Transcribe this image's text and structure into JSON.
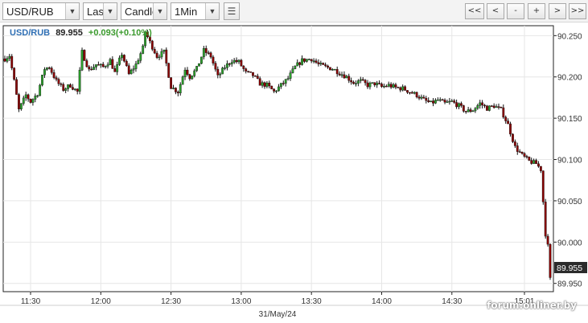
{
  "toolbar": {
    "symbol": "USD/RUB",
    "price_type": "Last",
    "chart_style": "Candle",
    "interval": "1Min",
    "list_icon": "list-icon",
    "nav": [
      "<<",
      "<",
      "-",
      "+",
      ">",
      ">>"
    ]
  },
  "quote": {
    "symbol": "USD/RUB",
    "price": "89.955",
    "change": "+0.093(+0.10%)"
  },
  "colors": {
    "up": "#2ca02c",
    "down": "#8b0000",
    "symbol": "#2f6fb4",
    "change": "#3a9a2c",
    "grid": "#e6e6e6"
  },
  "watermark": "forum.onliner.by",
  "chart_data": {
    "type": "candlestick",
    "title": "USD/RUB 89.955 +0.093(+0.10%)",
    "date_label": "31/May/24",
    "x_ticks": [
      "11:30",
      "12:00",
      "12:30",
      "13:00",
      "13:30",
      "14:00",
      "14:30",
      "15:01"
    ],
    "y_ticks": [
      "90.250",
      "90.200",
      "90.150",
      "90.100",
      "90.050",
      "90.000",
      "89.950"
    ],
    "ylim": [
      89.94,
      90.262
    ],
    "x_range": [
      "11:19",
      "15:12"
    ],
    "last_price_label": "89.955",
    "grid": true,
    "keypoints": [
      [
        "11:19",
        90.222
      ],
      [
        "11:21",
        90.226
      ],
      [
        "11:23",
        90.195
      ],
      [
        "11:25",
        90.16
      ],
      [
        "11:28",
        90.178
      ],
      [
        "11:30",
        90.17
      ],
      [
        "11:33",
        90.18
      ],
      [
        "11:36",
        90.21
      ],
      [
        "11:38",
        90.212
      ],
      [
        "11:41",
        90.195
      ],
      [
        "11:44",
        90.185
      ],
      [
        "11:47",
        90.19
      ],
      [
        "11:50",
        90.182
      ],
      [
        "11:52",
        90.23
      ],
      [
        "11:55",
        90.208
      ],
      [
        "11:58",
        90.215
      ],
      [
        "12:01",
        90.212
      ],
      [
        "12:04",
        90.22
      ],
      [
        "12:06",
        90.205
      ],
      [
        "12:09",
        90.228
      ],
      [
        "12:12",
        90.203
      ],
      [
        "12:15",
        90.215
      ],
      [
        "12:18",
        90.235
      ],
      [
        "12:19",
        90.255
      ],
      [
        "12:21",
        90.242
      ],
      [
        "12:24",
        90.225
      ],
      [
        "12:27",
        90.23
      ],
      [
        "12:30",
        90.188
      ],
      [
        "12:33",
        90.182
      ],
      [
        "12:36",
        90.21
      ],
      [
        "12:38",
        90.2
      ],
      [
        "12:41",
        90.21
      ],
      [
        "12:44",
        90.232
      ],
      [
        "12:47",
        90.225
      ],
      [
        "12:50",
        90.2
      ],
      [
        "12:53",
        90.212
      ],
      [
        "12:56",
        90.22
      ],
      [
        "12:59",
        90.218
      ],
      [
        "13:02",
        90.205
      ],
      [
        "13:05",
        90.202
      ],
      [
        "13:08",
        90.192
      ],
      [
        "13:11",
        90.19
      ],
      [
        "13:14",
        90.182
      ],
      [
        "13:17",
        90.19
      ],
      [
        "13:20",
        90.198
      ],
      [
        "13:23",
        90.212
      ],
      [
        "13:26",
        90.22
      ],
      [
        "13:30",
        90.222
      ],
      [
        "13:33",
        90.215
      ],
      [
        "13:36",
        90.212
      ],
      [
        "13:39",
        90.21
      ],
      [
        "13:42",
        90.205
      ],
      [
        "13:45",
        90.2
      ],
      [
        "13:48",
        90.193
      ],
      [
        "13:51",
        90.195
      ],
      [
        "13:54",
        90.19
      ],
      [
        "13:57",
        90.192
      ],
      [
        "14:00",
        90.188
      ],
      [
        "14:03",
        90.19
      ],
      [
        "14:06",
        90.187
      ],
      [
        "14:09",
        90.186
      ],
      [
        "14:12",
        90.182
      ],
      [
        "14:15",
        90.178
      ],
      [
        "14:18",
        90.172
      ],
      [
        "14:21",
        90.168
      ],
      [
        "14:24",
        90.172
      ],
      [
        "14:27",
        90.168
      ],
      [
        "14:30",
        90.17
      ],
      [
        "14:33",
        90.165
      ],
      [
        "14:36",
        90.158
      ],
      [
        "14:39",
        90.16
      ],
      [
        "14:42",
        90.168
      ],
      [
        "14:45",
        90.162
      ],
      [
        "14:48",
        90.165
      ],
      [
        "14:51",
        90.16
      ],
      [
        "14:54",
        90.142
      ],
      [
        "14:57",
        90.115
      ],
      [
        "15:00",
        90.105
      ],
      [
        "15:03",
        90.098
      ],
      [
        "15:06",
        90.095
      ],
      [
        "15:08",
        90.088
      ],
      [
        "15:10",
        90.01
      ],
      [
        "15:11",
        89.995
      ],
      [
        "15:12",
        89.955
      ]
    ]
  }
}
